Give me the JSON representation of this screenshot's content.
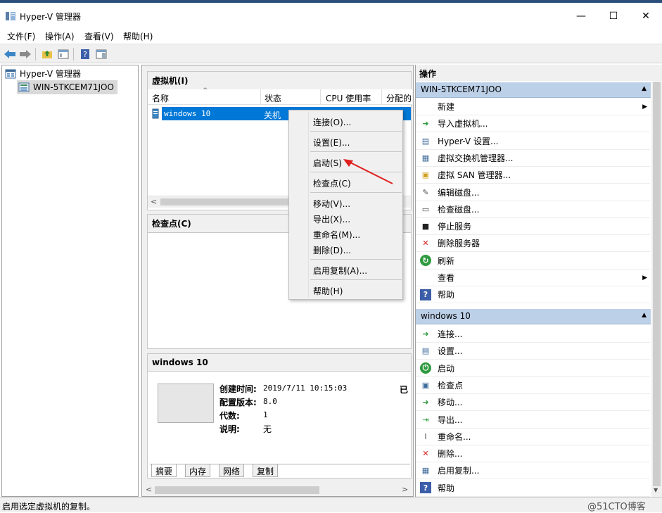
{
  "window": {
    "title": "Hyper-V 管理器",
    "minimize": "—",
    "maximize": "☐",
    "close": "✕"
  },
  "menu": [
    "文件(F)",
    "操作(A)",
    "查看(V)",
    "帮助(H)"
  ],
  "tree": {
    "root": "Hyper-V 管理器",
    "server": "WIN-5TKCEM71JOO"
  },
  "vm_panel": {
    "title": "虚拟机(I)",
    "columns": [
      "名称",
      "状态",
      "CPU 使用率",
      "分配的"
    ],
    "rows": [
      {
        "name": "windows 10",
        "state": "关机"
      }
    ]
  },
  "checkpoint_panel": {
    "title": "检查点(C)"
  },
  "details": {
    "title": "windows 10",
    "fields": [
      {
        "label": "创建时间:",
        "value": "2019/7/11 10:15:03"
      },
      {
        "label": "配置版本:",
        "value": "8.0"
      },
      {
        "label": "代数:",
        "value": "1"
      },
      {
        "label": "说明:",
        "value": "无"
      }
    ],
    "side_text": "已",
    "tabs": [
      "摘要",
      "内存",
      "网络",
      "复制"
    ]
  },
  "context_menu": {
    "items": [
      "连接(O)...",
      "设置(E)...",
      "启动(S)",
      "检查点(C)",
      "移动(V)...",
      "导出(X)...",
      "重命名(M)...",
      "删除(D)...",
      "启用复制(A)...",
      "帮助(H)"
    ]
  },
  "actions": {
    "title": "操作",
    "server_section": {
      "title": "WIN-5TKCEM71JOO",
      "items": [
        "新建",
        "导入虚拟机...",
        "Hyper-V 设置...",
        "虚拟交换机管理器...",
        "虚拟 SAN 管理器...",
        "编辑磁盘...",
        "检查磁盘...",
        "停止服务",
        "删除服务器",
        "刷新",
        "查看",
        "帮助"
      ]
    },
    "vm_section": {
      "title": "windows 10",
      "items": [
        "连接...",
        "设置...",
        "启动",
        "检查点",
        "移动...",
        "导出...",
        "重命名...",
        "删除...",
        "启用复制...",
        "帮助"
      ]
    }
  },
  "status": {
    "text": "启用选定虚拟机的复制。",
    "watermark": "@51CTO博客"
  },
  "colors": {
    "selection": "#0078d7",
    "section_header": "#bcd0e8",
    "arrow": "#e02020"
  }
}
